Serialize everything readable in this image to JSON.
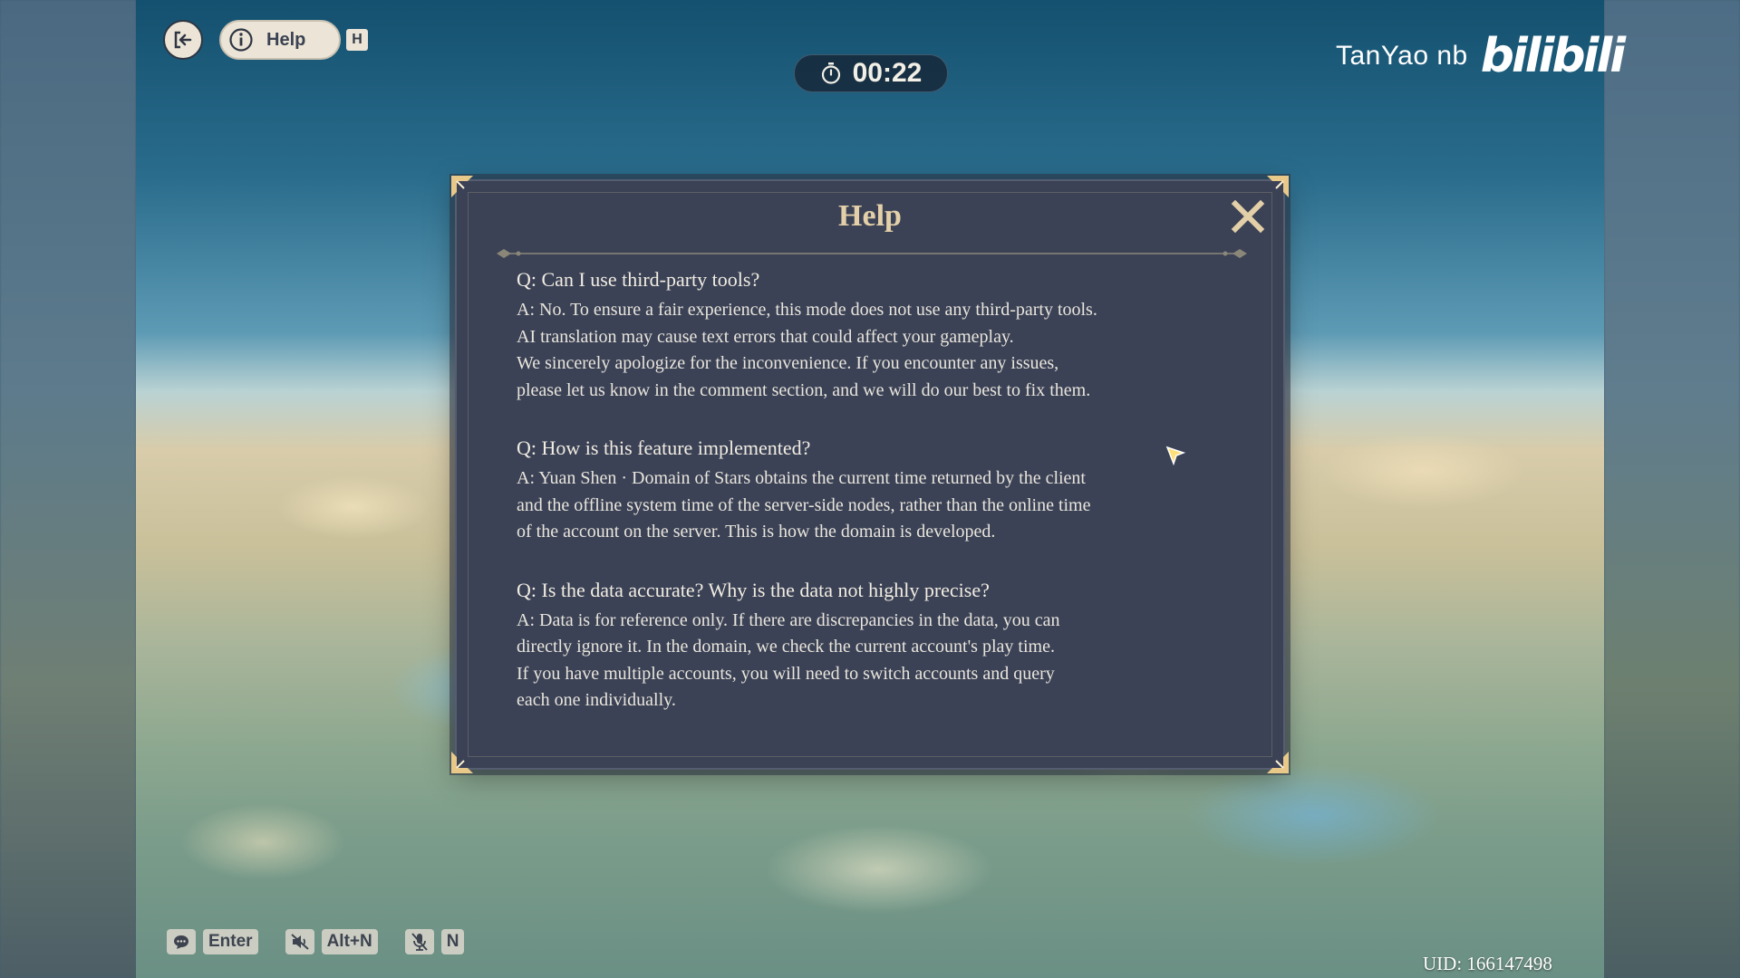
{
  "hud": {
    "help_label": "Help",
    "help_key": "H",
    "timer": "00:22"
  },
  "watermark": {
    "name": "TanYao nb",
    "logo": "bilibili"
  },
  "dialog": {
    "title": "Help",
    "faq": [
      {
        "q": "Q: Can I use third-party tools?",
        "a": "A: No. To ensure a fair experience, this mode does not use any third-party tools.\nAI translation may cause text errors that could affect your gameplay.\nWe sincerely apologize for the inconvenience. If you encounter any issues,\nplease let us know in the comment section, and we will do our best to fix them."
      },
      {
        "q": "Q: How is this feature implemented?",
        "a": "A: Yuan Shen · Domain of Stars obtains the current time returned by the client\nand the offline system time of the server-side nodes, rather than the online time\nof the account on the server. This is how the domain is developed."
      },
      {
        "q": "Q: Is the data accurate? Why is the data not highly precise?",
        "a": "A: Data is for reference only. If there are discrepancies in the data, you can\ndirectly ignore it. In the domain, we check the current account's play time.\nIf you have multiple accounts, you will need to switch accounts and query\neach one individually."
      }
    ]
  },
  "bottom_bar": {
    "chat_key": "Enter",
    "mute_key": "Alt+N",
    "mic_key": "N"
  },
  "uid": "UID: 166147498",
  "colors": {
    "dialog_bg": "#3b4256",
    "title_gold": "#e3cfa8",
    "corner_gold": "#e9c98a"
  }
}
